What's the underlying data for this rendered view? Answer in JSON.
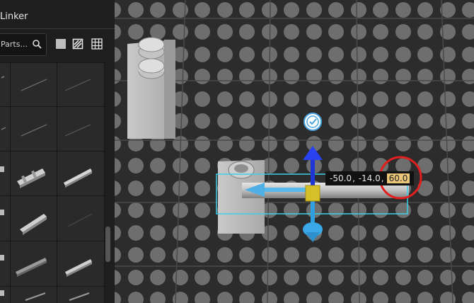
{
  "sidebar": {
    "title": "Linker",
    "search_placeholder": "Parts...",
    "icons": [
      "search-icon",
      "solid-square-icon",
      "hatched-square-icon",
      "grid-icon"
    ],
    "parts": [
      [
        "diagonal-rod",
        "diagonal-rod",
        "diagonal-rod"
      ],
      [
        "diagonal-rod",
        "diagonal-rod",
        "diagonal-rod"
      ],
      [
        "axle-part",
        "connector-part",
        "pin-part"
      ],
      [
        "axle-part",
        "pin-part",
        "diagonal-rod"
      ],
      [
        "axle-part",
        "long-pin-part",
        "pin-part"
      ],
      [
        "axle-part",
        "pin-part",
        "pin-part"
      ]
    ]
  },
  "viewport": {
    "coordinate": {
      "x": "-50.0",
      "y": "-14.0",
      "z": "60.0",
      "separator": ","
    },
    "confirm_icon": "checkmark-icon",
    "gizmo": [
      "up-arrow-handle",
      "down-arrow-handle",
      "left-arrow-handle"
    ],
    "highlight": "red-circle-annotation"
  }
}
